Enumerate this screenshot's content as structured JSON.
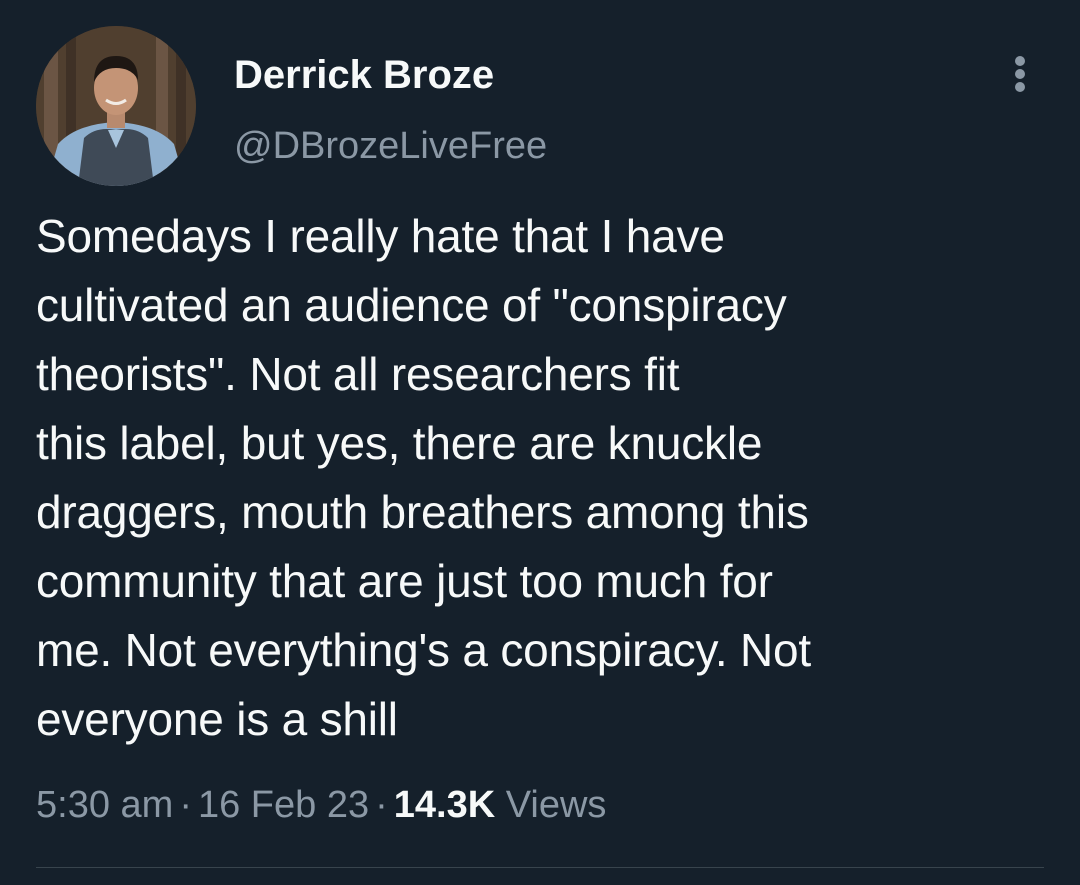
{
  "author": {
    "display_name": "Derrick Broze",
    "handle": "@DBrozeLiveFree",
    "avatar_icon": "profile-photo"
  },
  "more_icon": "more-vertical-icon",
  "tweet": {
    "lines": [
      "Somedays I really hate that I have",
      "cultivated an audience of \"conspiracy",
      "theorists\". Not all researchers fit",
      "this label, but yes, there are knuckle",
      "draggers, mouth breathers among this",
      "community that are just too much for",
      "me. Not everything's a conspiracy. Not",
      "everyone is a shill"
    ]
  },
  "meta": {
    "time": "5:30 am",
    "separator": "·",
    "date": "16 Feb 23",
    "views_count": "14.3K",
    "views_label": "Views"
  },
  "colors": {
    "background": "#15202b",
    "primary_text": "#f7f9f9",
    "secondary_text": "#8b98a5",
    "divider": "#38444d"
  }
}
